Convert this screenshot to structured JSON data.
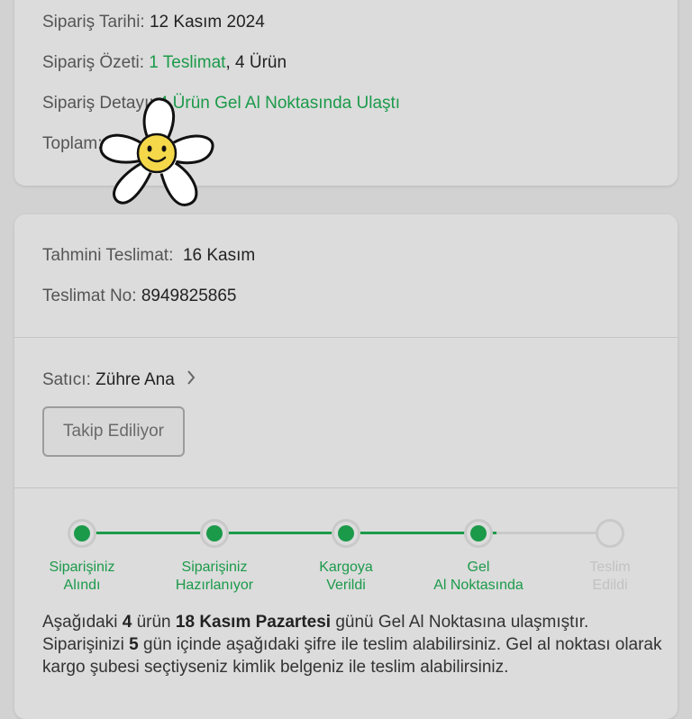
{
  "order_summary": {
    "date_label": "Sipariş Tarihi:",
    "date_value": "12 Kasım 2024",
    "summary_label": "Sipariş Özeti:",
    "summary_delivery": "1 Teslimat",
    "summary_separator": ",",
    "summary_items": "4 Ürün",
    "detail_label": "Sipariş Detayı:",
    "detail_value": "4 Ürün Gel Al Noktasında Ulaştı",
    "total_label": "Toplam:"
  },
  "delivery": {
    "estimated_label": "Tahmini Teslimat:",
    "estimated_value": "16 Kasım",
    "number_label": "Teslimat No:",
    "number_value": "8949825865"
  },
  "seller": {
    "label": "Satıcı:",
    "name": "Zühre Ana",
    "follow_button": "Takip Ediliyor"
  },
  "tracking_steps": [
    {
      "line1": "Siparişiniz",
      "line2": "Alındı",
      "status": "done"
    },
    {
      "line1": "Siparişiniz",
      "line2": "Hazırlanıyor",
      "status": "done"
    },
    {
      "line1": "Kargoya",
      "line2": "Verildi",
      "status": "done"
    },
    {
      "line1": "Gel",
      "line2": "Al Noktasında",
      "status": "done"
    },
    {
      "line1": "Teslim",
      "line2": "Edildi",
      "status": "pending"
    }
  ],
  "description": {
    "p1": "Aşağıdaki ",
    "b1": "4",
    "p2": " ürün ",
    "b2": "18 Kasım Pazartesi",
    "p3": " günü Gel Al Noktasına ulaşmıştır. Siparişinizi ",
    "b3": "5",
    "p4": " gün içinde aşağıdaki şifre ile teslim alabilirsiniz. Gel al noktası olarak kargo şubesi seçtiyseniz kimlik belgeniz ile teslim alabilirsiniz."
  },
  "colors": {
    "accent_green": "#1b9a4a",
    "pending_gray": "#c9c9c9",
    "background": "#d2d2d2",
    "card": "#dcdcdc"
  },
  "icons": {
    "seller_chevron": "chevron-right-icon",
    "sticker": "smiling-flower-sticker"
  }
}
